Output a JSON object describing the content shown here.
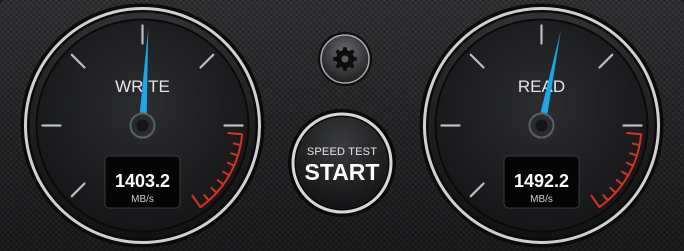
{
  "gauges": [
    {
      "id": "write",
      "label": "WRITE",
      "value": "1403.2",
      "unit": "MB/s",
      "needle_color": "#1aa9e6",
      "needle_fraction": 0.52
    },
    {
      "id": "read",
      "label": "READ",
      "value": "1492.2",
      "unit": "MB/s",
      "needle_color": "#1aa9e6",
      "needle_fraction": 0.55
    }
  ],
  "settings": {
    "icon": "gear-icon"
  },
  "start_button": {
    "subtitle": "SPEED TEST",
    "label": "START"
  },
  "colors": {
    "redline": "#d8321c",
    "needle": "#1aa9e6"
  }
}
